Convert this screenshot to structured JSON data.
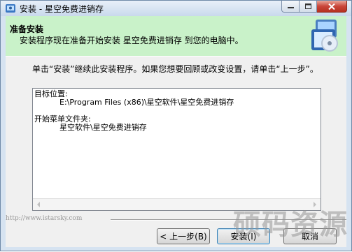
{
  "window": {
    "title": "安装 - 星空免费进销存",
    "caption_buttons": [
      "minimize",
      "maximize",
      "close"
    ]
  },
  "header": {
    "title": "准备安装",
    "subtitle": "安装程序现在准备开始安装 星空免费进销存 到您的电脑中。",
    "icon": "setup-disk-icon"
  },
  "body": {
    "intro": "单击“安装”继续此安装程序。如果您想要回顾或改变设置，请单击“上一步”。",
    "memo": {
      "dest_label": "目标位置:",
      "dest_value": "E:\\Program Files (x86)\\星空软件\\星空免费进销存",
      "menu_label": "开始菜单文件夹:",
      "menu_value": "星空软件\\星空免费进销存"
    }
  },
  "footer": {
    "url": "http://www.istarsky.com",
    "buttons": {
      "back": "< 上一步(B)",
      "install": "安装(I)",
      "cancel": "取消"
    }
  },
  "watermark": "硕码资源",
  "colors": {
    "header_bg": "#c9f2c9",
    "window_frame": "#d6e3f1",
    "close_red": "#c9463a"
  }
}
